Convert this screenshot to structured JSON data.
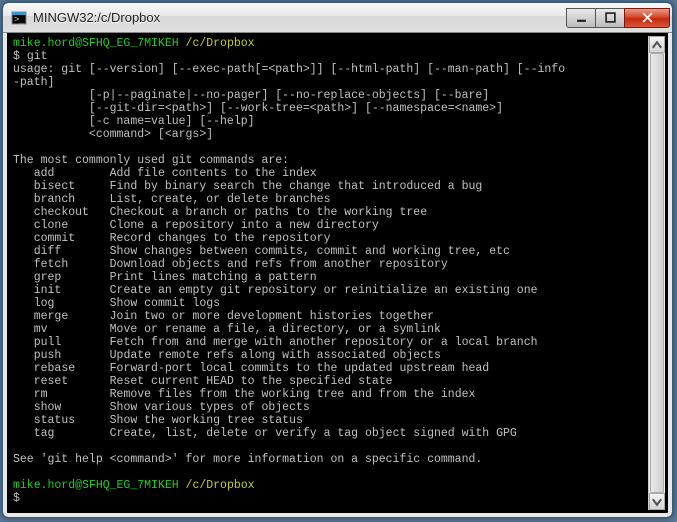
{
  "window": {
    "title": "MINGW32:/c/Dropbox"
  },
  "prompt1": {
    "user_host": "mike.hord@SFHQ_EG_7MIKEH",
    "path": " /c/Dropbox",
    "cmd_prefix": "$ ",
    "cmd": "git"
  },
  "usage": {
    "l1": "usage: git [--version] [--exec-path[=<path>]] [--html-path] [--man-path] [--info",
    "l2": "-path]",
    "l3": "           [-p|--paginate|--no-pager] [--no-replace-objects] [--bare]",
    "l4": "           [--git-dir=<path>] [--work-tree=<path>] [--namespace=<name>]",
    "l5": "           [-c name=value] [--help]",
    "l6": "           <command> [<args>]"
  },
  "heading": "The most commonly used git commands are:",
  "commands": [
    {
      "name": "add",
      "desc": "Add file contents to the index"
    },
    {
      "name": "bisect",
      "desc": "Find by binary search the change that introduced a bug"
    },
    {
      "name": "branch",
      "desc": "List, create, or delete branches"
    },
    {
      "name": "checkout",
      "desc": "Checkout a branch or paths to the working tree"
    },
    {
      "name": "clone",
      "desc": "Clone a repository into a new directory"
    },
    {
      "name": "commit",
      "desc": "Record changes to the repository"
    },
    {
      "name": "diff",
      "desc": "Show changes between commits, commit and working tree, etc"
    },
    {
      "name": "fetch",
      "desc": "Download objects and refs from another repository"
    },
    {
      "name": "grep",
      "desc": "Print lines matching a pattern"
    },
    {
      "name": "init",
      "desc": "Create an empty git repository or reinitialize an existing one"
    },
    {
      "name": "log",
      "desc": "Show commit logs"
    },
    {
      "name": "merge",
      "desc": "Join two or more development histories together"
    },
    {
      "name": "mv",
      "desc": "Move or rename a file, a directory, or a symlink"
    },
    {
      "name": "pull",
      "desc": "Fetch from and merge with another repository or a local branch"
    },
    {
      "name": "push",
      "desc": "Update remote refs along with associated objects"
    },
    {
      "name": "rebase",
      "desc": "Forward-port local commits to the updated upstream head"
    },
    {
      "name": "reset",
      "desc": "Reset current HEAD to the specified state"
    },
    {
      "name": "rm",
      "desc": "Remove files from the working tree and from the index"
    },
    {
      "name": "show",
      "desc": "Show various types of objects"
    },
    {
      "name": "status",
      "desc": "Show the working tree status"
    },
    {
      "name": "tag",
      "desc": "Create, list, delete or verify a tag object signed with GPG"
    }
  ],
  "footer": "See 'git help <command>' for more information on a specific command.",
  "prompt2": {
    "user_host": "mike.hord@SFHQ_EG_7MIKEH",
    "path": " /c/Dropbox",
    "cmd_prefix": "$ "
  }
}
